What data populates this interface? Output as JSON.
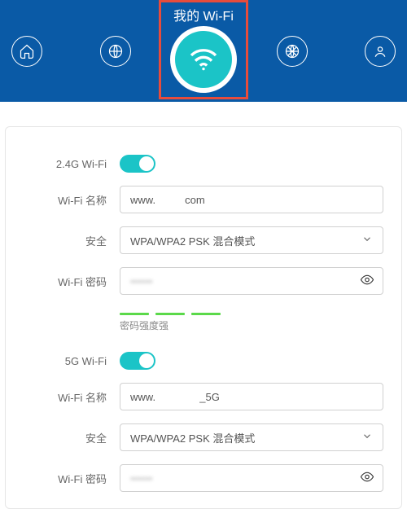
{
  "header": {
    "title": "我的 Wi-Fi"
  },
  "wifi24": {
    "section_label": "2.4G Wi-Fi",
    "name_label": "Wi-Fi 名称",
    "name_value": "www.          com",
    "security_label": "安全",
    "security_value": "WPA/WPA2 PSK 混合模式",
    "password_label": "Wi-Fi 密码",
    "password_value": "••••••",
    "strength_label": "密码强度强"
  },
  "wifi5": {
    "section_label": "5G Wi-Fi",
    "name_label": "Wi-Fi 名称",
    "name_value": "www.               _5G",
    "security_label": "安全",
    "security_value": "WPA/WPA2 PSK 混合模式",
    "password_label": "Wi-Fi 密码",
    "password_value": "••••••"
  }
}
